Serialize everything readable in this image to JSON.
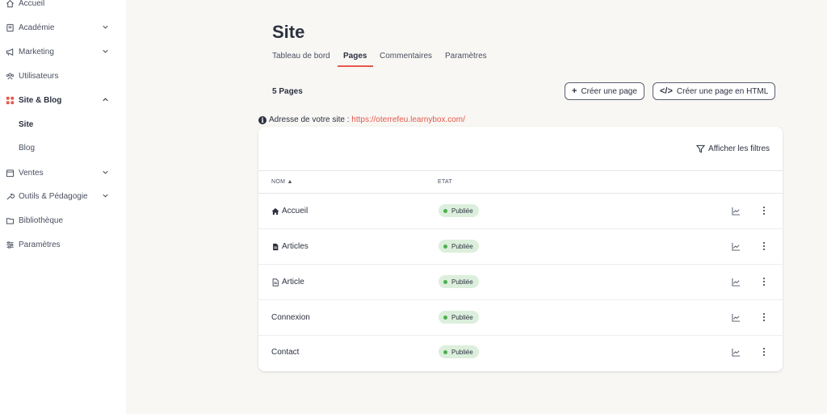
{
  "sidebar": {
    "items": [
      {
        "label": "Accueil",
        "icon": "home-icon"
      },
      {
        "label": "Académie",
        "icon": "book-icon"
      },
      {
        "label": "Marketing",
        "icon": "megaphone-icon"
      },
      {
        "label": "Utilisateurs",
        "icon": "users-icon"
      },
      {
        "label": "Site & Blog",
        "icon": "grid-icon"
      },
      {
        "label": "Site"
      },
      {
        "label": "Blog"
      },
      {
        "label": "Ventes",
        "icon": "store-icon"
      },
      {
        "label": "Outils & Pédagogie",
        "icon": "wrench-icon"
      },
      {
        "label": "Bibliothèque",
        "icon": "folder-icon"
      },
      {
        "label": "Paramètres",
        "icon": "sliders-icon"
      }
    ]
  },
  "page": {
    "title": "Site",
    "tabs": [
      {
        "label": "Tableau de bord"
      },
      {
        "label": "Pages"
      },
      {
        "label": "Commentaires"
      },
      {
        "label": "Paramètres"
      }
    ],
    "count": "5 Pages",
    "create_button": "Créer une page",
    "create_html_button": "Créer une page en HTML",
    "address_label": "Adresse de votre site :",
    "address_url": "https://oterrefeu.learnybox.com/",
    "filters_label": "Afficher les filtres"
  },
  "table": {
    "columns": {
      "name": "NOM",
      "status": "ETAT"
    },
    "rows": [
      {
        "name": "Accueil",
        "icon": "home-icon",
        "status": "Publiée"
      },
      {
        "name": "Articles",
        "icon": "document-icon",
        "status": "Publiée"
      },
      {
        "name": "Article",
        "icon": "document-outline-icon",
        "status": "Publiée"
      },
      {
        "name": "Connexion",
        "status": "Publiée"
      },
      {
        "name": "Contact",
        "status": "Publiée"
      }
    ]
  },
  "colors": {
    "accent": "#e8574a",
    "status_bg": "#dcefdc",
    "status_dot": "#4caf50"
  }
}
